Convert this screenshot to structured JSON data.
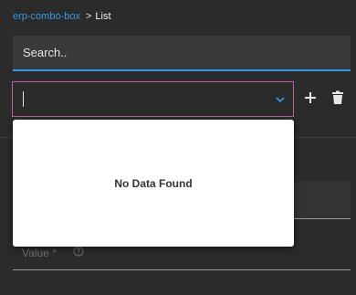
{
  "breadcrumb": {
    "parent": "erp-combo-box",
    "separator": ">",
    "current": "List"
  },
  "search": {
    "placeholder": "Search..",
    "value": ""
  },
  "combo": {
    "value": "",
    "dropdown_icon": "chevron-down-icon",
    "empty_message": "No Data Found"
  },
  "toolbar": {
    "add_icon": "plus-icon",
    "delete_icon": "trash-icon"
  },
  "form": {
    "value_label": "Value *",
    "help_icon": "question-circle-icon"
  },
  "colors": {
    "accent": "#2f9be8",
    "combo_border": "#c2609e",
    "background": "#2b2b2b"
  }
}
